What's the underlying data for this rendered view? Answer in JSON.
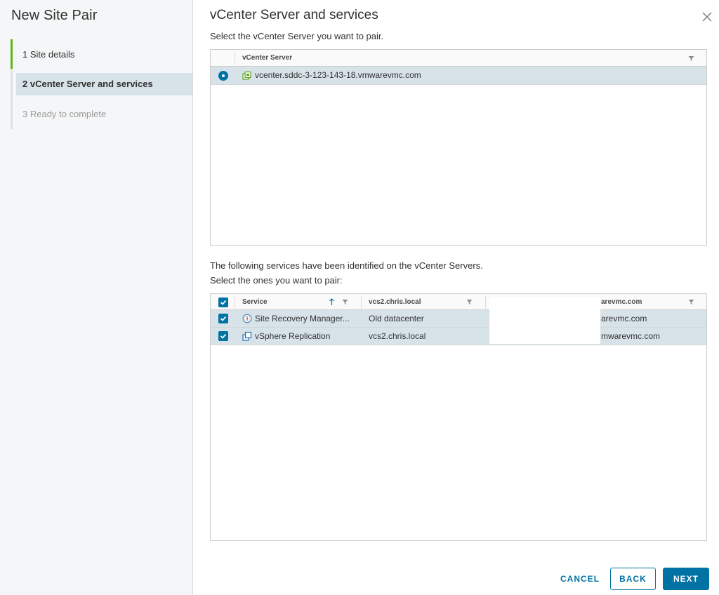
{
  "wizard": {
    "title": "New Site Pair",
    "steps": [
      {
        "label": "1 Site details",
        "state": "completed"
      },
      {
        "label": "2 vCenter Server and services",
        "state": "active"
      },
      {
        "label": "3 Ready to complete",
        "state": "disabled"
      }
    ]
  },
  "main": {
    "title": "vCenter Server and services",
    "subtitle": "Select the vCenter Server you want to pair."
  },
  "vcenter_grid": {
    "column_header": "vCenter Server",
    "rows": [
      {
        "name": "vcenter.sddc-3-123-143-18.vmwarevmc.com",
        "selected": true
      }
    ]
  },
  "services_text": {
    "line1": "The following services have been identified on the vCenter Servers.",
    "line2": "Select the ones you want to pair:"
  },
  "services_grid": {
    "columns": [
      "Service",
      "vcs2.chris.local",
      "arevmc.com"
    ],
    "rows": [
      {
        "service": "Site Recovery Manager...",
        "col2": "Old datacenter",
        "col3": "arevmc.com",
        "checked": true,
        "icon": "site-recovery-icon"
      },
      {
        "service": "vSphere Replication",
        "col2": "vcs2.chris.local",
        "col3": "mwarevmc.com",
        "checked": true,
        "icon": "vsphere-replication-icon"
      }
    ]
  },
  "buttons": {
    "cancel": "CANCEL",
    "back": "BACK",
    "next": "NEXT"
  },
  "colors": {
    "accent": "#0072a3",
    "completed": "#60b515",
    "selected_row": "#d8e3e9"
  }
}
